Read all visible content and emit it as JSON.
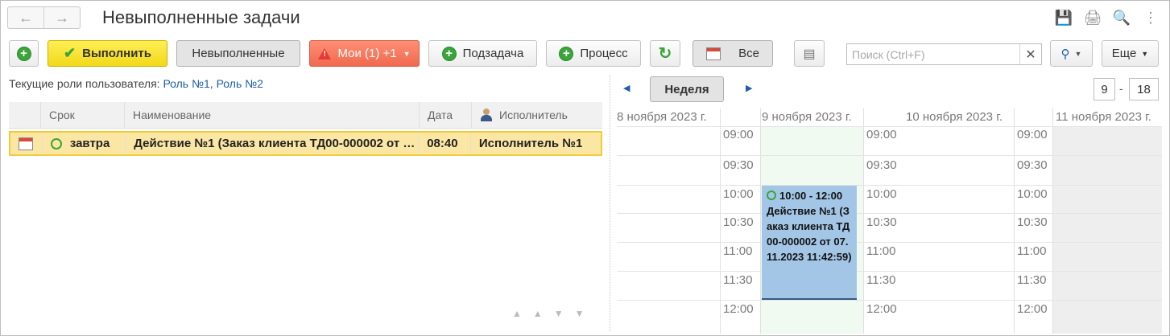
{
  "window": {
    "title": "Невыполненные задачи"
  },
  "toolbar": {
    "execute": "Выполнить",
    "unfinished": "Невыполненные",
    "mine": "Мои (1) +1",
    "subtask": "Подзадача",
    "process": "Процесс",
    "all": "Все",
    "search_placeholder": "Поиск (Ctrl+F)",
    "more": "Еще"
  },
  "roles": {
    "label": "Текущие роли пользователя:",
    "links": "Роль №1, Роль №2"
  },
  "grid": {
    "columns": [
      "Срок",
      "Наименование",
      "Дата",
      "Исполнитель"
    ],
    "rows": [
      {
        "due": "завтра",
        "name": "Действие №1 (Заказ клиента ТД00-000002 от 07.11.2023 11:42:59)",
        "date": "08:40",
        "assignee": "Исполнитель №1"
      }
    ]
  },
  "calendar": {
    "view_button": "Неделя",
    "hour_from": "9",
    "hour_to": "18",
    "range_separator": "-",
    "days": [
      "8 ноября 2023 г.",
      "9 ноября 2023 г.",
      "10 ноября 2023 г.",
      "11 ноября 2023 г."
    ],
    "times": [
      "09:00",
      "09:30",
      "10:00",
      "10:30",
      "11:00",
      "11:30",
      "12:00"
    ],
    "event": {
      "time": "10:00 - 12:00",
      "text": "Действие №1 (Заказ клиента ТД00-000002 от 07.11.2023 11:42:59)"
    }
  },
  "colors": {
    "event": "#a4c6e6",
    "row_highlight": "#fbe7a3",
    "execute_button": "#f2d91a",
    "warn_button": "#f06a4f",
    "link": "#1e5ea8"
  }
}
